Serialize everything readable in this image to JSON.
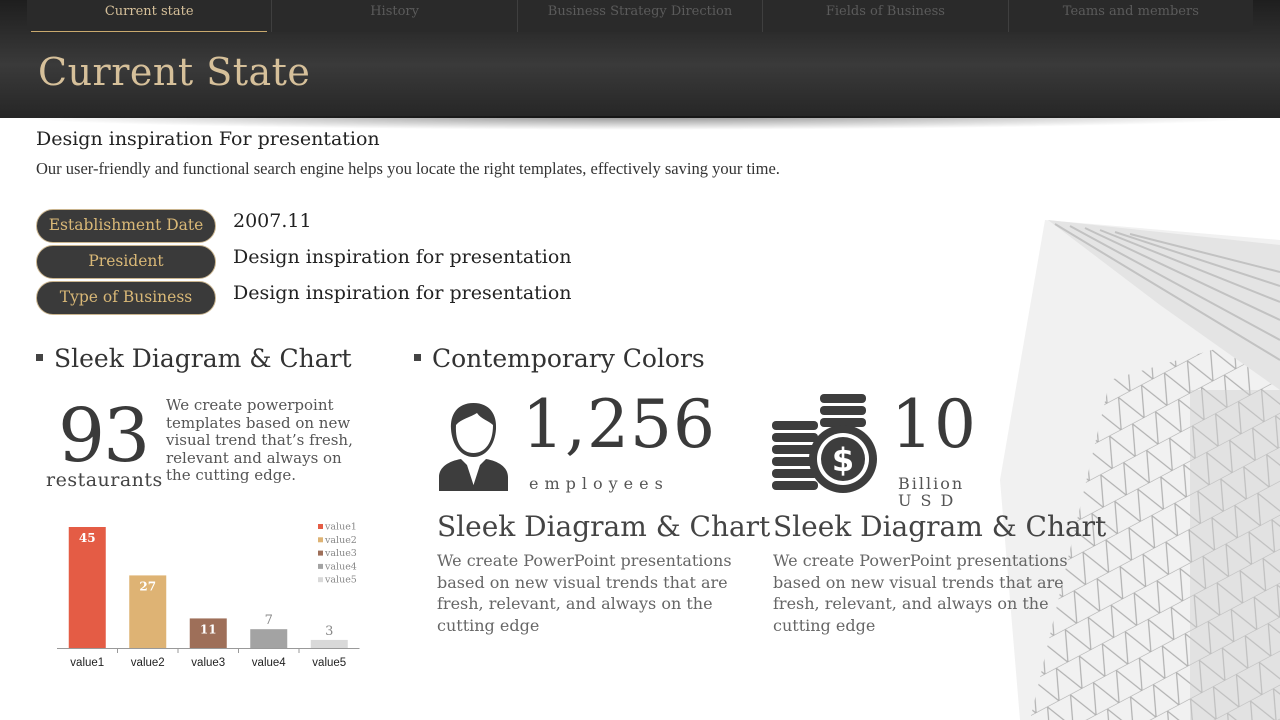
{
  "nav": {
    "tabs": [
      {
        "label": "Current state",
        "active": true
      },
      {
        "label": "History",
        "active": false
      },
      {
        "label": "Business Strategy Direction",
        "active": false
      },
      {
        "label": "Fields of Business",
        "active": false
      },
      {
        "label": "Teams and members",
        "active": false
      }
    ]
  },
  "header": {
    "title": "Current State"
  },
  "intro": {
    "subtitle": "Design inspiration For presentation",
    "description": "Our user-friendly and functional search engine helps you locate the right templates, effectively saving your time."
  },
  "info": [
    {
      "label": "Establishment Date",
      "value": "2007.11"
    },
    {
      "label": "President",
      "value": "Design inspiration for presentation"
    },
    {
      "label": "Type of Business",
      "value": "Design inspiration for presentation"
    }
  ],
  "left_section": {
    "heading": "Sleek Diagram & Chart",
    "big_number": "93",
    "big_unit": "restaurants",
    "paragraph": "We create powerpoint templates based on new visual trend that’s fresh, relevant and always on the cutting edge."
  },
  "right_section": {
    "heading": "Contemporary Colors",
    "stats": [
      {
        "icon": "person-icon",
        "number": "1,256",
        "unit": "employees",
        "card_title": "Sleek Diagram & Chart",
        "card_text": "We create PowerPoint presentations based on new visual trends that are fresh, relevant, and always on the cutting edge"
      },
      {
        "icon": "coins-dollar-icon",
        "number": "10",
        "unit_line1": "Billion",
        "unit_line2": "USD",
        "card_title": "Sleek Diagram & Chart",
        "card_text": "We create PowerPoint presentations based on new visual trends that are fresh, relevant, and always on the cutting edge"
      }
    ]
  },
  "colors": {
    "accent_gold": "#d6c09a",
    "header_dark": "#2a2a2a"
  },
  "chart_data": {
    "type": "bar",
    "categories": [
      "value1",
      "value2",
      "value3",
      "value4",
      "value5"
    ],
    "values": [
      45,
      27,
      11,
      7,
      3
    ],
    "colors": [
      "#e45c45",
      "#deb374",
      "#9e6f59",
      "#a3a3a3",
      "#d9d9d9"
    ],
    "legend": [
      "value1",
      "value2",
      "value3",
      "value4",
      "value5"
    ],
    "legend_position": "top-right",
    "ylim": [
      0,
      45
    ],
    "grid": false
  }
}
